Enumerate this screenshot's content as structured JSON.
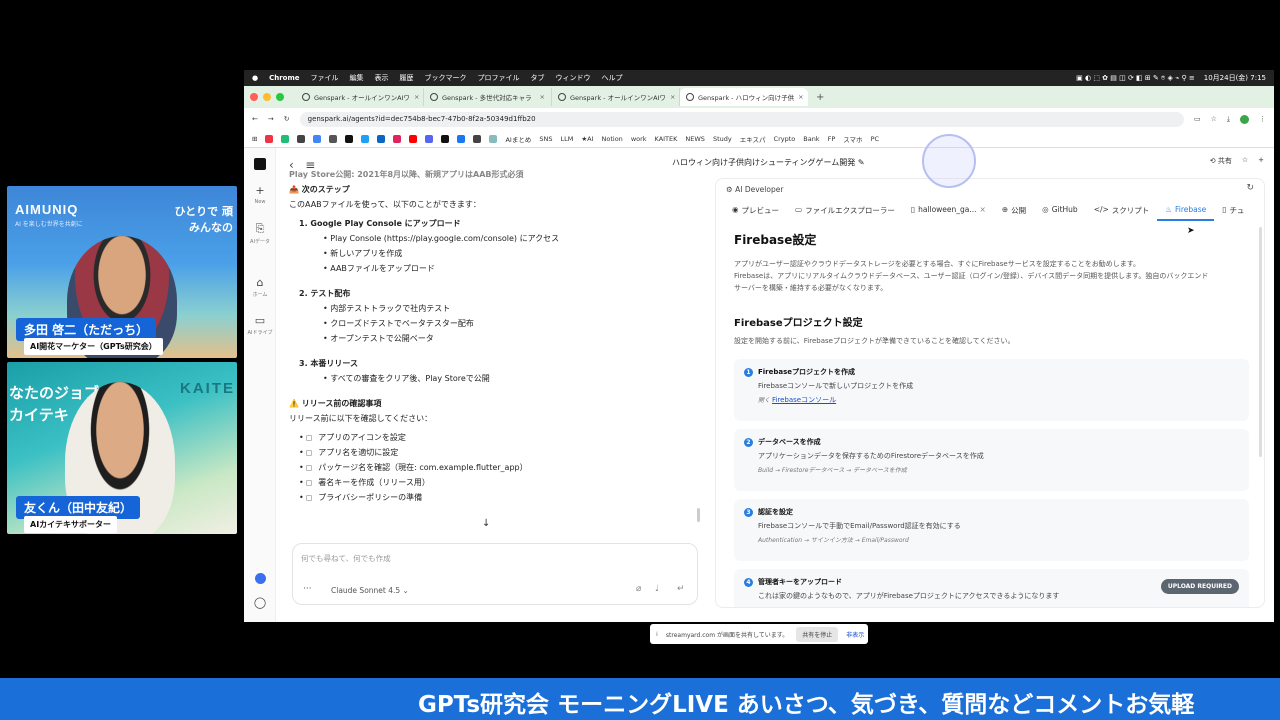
{
  "cam1": {
    "brand": "AIMUNIQ",
    "brand_sub": "AI を楽しむ世界を共創に",
    "tagline": "ひとりで 頑\nみんなの",
    "name": "多田 啓二（ただっち）",
    "role": "AI開花マーケター（GPTs研究会）"
  },
  "cam2": {
    "big_text": "なたのジョブ\nカイテキ",
    "kaite": "KAITE",
    "name": "友くん（田中友紀）",
    "role": "AIカイテキサポーター"
  },
  "menubar": {
    "apple": "",
    "app": "Chrome",
    "items": [
      "ファイル",
      "編集",
      "表示",
      "履歴",
      "ブックマーク",
      "プロファイル",
      "タブ",
      "ウィンドウ",
      "ヘルプ"
    ],
    "clock": "10月24日(金) 7:15"
  },
  "tabs": [
    {
      "label": "Genspark - オールインワンAIワ"
    },
    {
      "label": "Genspark - 多世代対応キャラ"
    },
    {
      "label": "Genspark - オールインワンAIワ"
    },
    {
      "label": "Genspark - ハロウィン向け子供"
    }
  ],
  "address": {
    "url": "genspark.ai/agents?id=dec754b8-bec7-47b0-8f2a-50349d1ffb20"
  },
  "bookmarks": [
    "AIまとめ",
    "SNS",
    "LLM",
    "★AI",
    "Notion",
    "work",
    "KAITEK",
    "NEWS",
    "Study",
    "エキスパ",
    "Crypto",
    "Bank",
    "FP",
    "スマホ",
    "PC"
  ],
  "rail": [
    {
      "icon": "+",
      "label": "New"
    },
    {
      "icon": "⎘",
      "label": "AIデータ"
    },
    {
      "icon": "⌂",
      "label": "ホーム"
    },
    {
      "icon": "▭",
      "label": "AIドライブ"
    }
  ],
  "page": {
    "title": "ハロウィン向け子供向けシューティングゲーム開発 ✎",
    "share": "共有"
  },
  "chat": {
    "cut_line": "Play Store公開: 2021年8月以降、新規アプリはAAB形式必須",
    "next_heading": "📤 次のステップ",
    "next_intro": "このAABファイルを使って、以下のことができます：",
    "step1_title": "1. Google Play Console にアップロード",
    "step1_items": [
      "Play Console (https://play.google.com/console) にアクセス",
      "新しいアプリを作成",
      "AABファイルをアップロード"
    ],
    "step1_link": "https://play.google.com/console",
    "step2_title": "2. テスト配布",
    "step2_items": [
      "内部テストトラックで社内テスト",
      "クローズドテストでベータテスター配布",
      "オープンテストで公開ベータ"
    ],
    "step3_title": "3. 本番リリース",
    "step3_items": [
      "すべての審査をクリア後、Play Storeで公開"
    ],
    "warn_heading": "⚠️ リリース前の確認事項",
    "warn_intro": "リリース前に以下を確認してください：",
    "checklist": [
      "アプリのアイコンを設定",
      "アプリ名を適切に設定",
      "パッケージ名を確認（現在: com.example.flutter_app）",
      "署名キーを作成（リリース用）",
      "プライバシーポリシーの準備"
    ],
    "input_placeholder": "何でも尋ねて、何でも作成",
    "model": "Claude Sonnet 4.5 ⌄"
  },
  "panel": {
    "header": "AI Developer",
    "tabs": [
      "プレビュー",
      "ファイルエクスプローラー",
      "halloween_ga...",
      "公開",
      "GitHub",
      "スクリプト",
      "Firebase",
      "チュ"
    ],
    "title": "Firebase設定",
    "desc1": "アプリがユーザー認証やクラウドデータストレージを必要とする場合、すぐにFirebaseサービスを設定することをお勧めします。",
    "desc2": "Firebaseは、アプリにリアルタイムクラウドデータベース、ユーザー認証（ログイン/登録）、デバイス間データ同期を提供します。独自のバックエンド",
    "desc3": "サーバーを構築・維持する必要がなくなります。",
    "proj_title": "Firebaseプロジェクト設定",
    "proj_desc": "設定を開始する前に、Firebaseプロジェクトが準備できていることを確認してください。",
    "steps": [
      {
        "num": "1",
        "title": "Firebaseプロジェクトを作成",
        "desc": "Firebaseコンソールで新しいプロジェクトを作成",
        "path_prefix": "開く",
        "path_link": "Firebaseコンソール"
      },
      {
        "num": "2",
        "title": "データベースを作成",
        "desc": "アプリケーションデータを保存するためのFirestoreデータベースを作成",
        "path": "Build → Firestoreデータベース → データベースを作成"
      },
      {
        "num": "3",
        "title": "認証を設定",
        "desc": "Firebaseコンソールで手動でEmail/Password認証を有効にする",
        "path": "Authentication → サインイン方法 → Email/Password"
      },
      {
        "num": "4",
        "title": "管理者キーをアップロード",
        "desc": "これは家の鍵のようなもので、アプリがFirebaseプロジェクトにアクセスできるようになります",
        "badge": "UPLOAD REQUIRED"
      }
    ]
  },
  "sharebar": {
    "text": "streamyard.com が画面を共有しています。",
    "stop": "共有を停止",
    "hide": "非表示"
  },
  "ticker": "GPTs研究会 モーニングLIVE あいさつ、気づき、質問などコメントお気軽"
}
